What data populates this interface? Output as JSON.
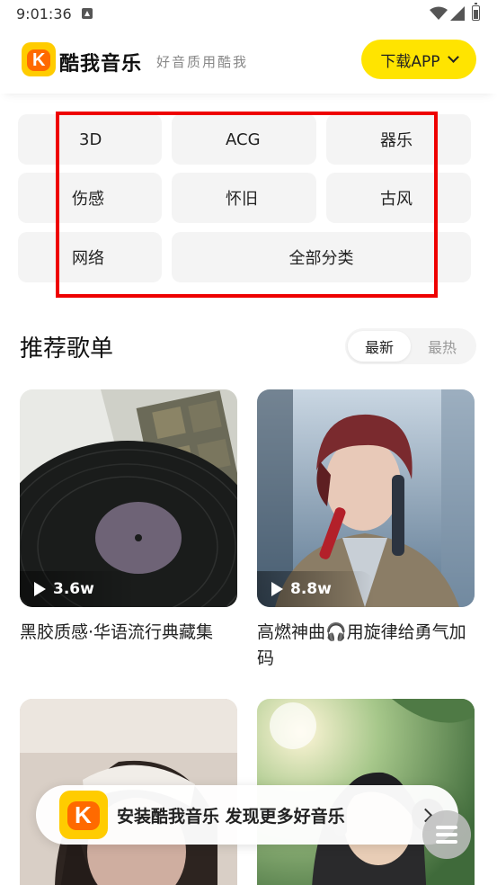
{
  "status_bar": {
    "time": "9:01:36"
  },
  "header": {
    "brand": "酷我音乐",
    "slogan": "好音质用酷我",
    "download_label": "下载APP",
    "brand_colors": {
      "yellow": "#ffcc00",
      "orange": "#ff6a00",
      "button": "#ffe400"
    }
  },
  "categories": {
    "items": [
      "3D",
      "ACG",
      "器乐",
      "伤感",
      "怀旧",
      "古风",
      "网络"
    ],
    "all_label": "全部分类",
    "highlight_color": "#ee0000"
  },
  "recommended": {
    "title": "推荐歌单",
    "sort_options": [
      "最新",
      "最热"
    ],
    "active_sort": "最新",
    "playlists": [
      {
        "play_count": "3.6w",
        "title": "黑胶质感·华语流行典藏集",
        "cover": "vinyl-record-image"
      },
      {
        "play_count": "8.8w",
        "title": "高燃神曲🎧用旋律给勇气加码",
        "cover": "singer-with-headphones-image"
      },
      {
        "play_count": "",
        "title": "",
        "cover": "person-with-headband-image"
      },
      {
        "play_count": "",
        "title": "",
        "cover": "girl-with-headphones-sunlight-image"
      }
    ]
  },
  "install_banner": {
    "text": "安装酷我音乐 发现更多好音乐"
  }
}
